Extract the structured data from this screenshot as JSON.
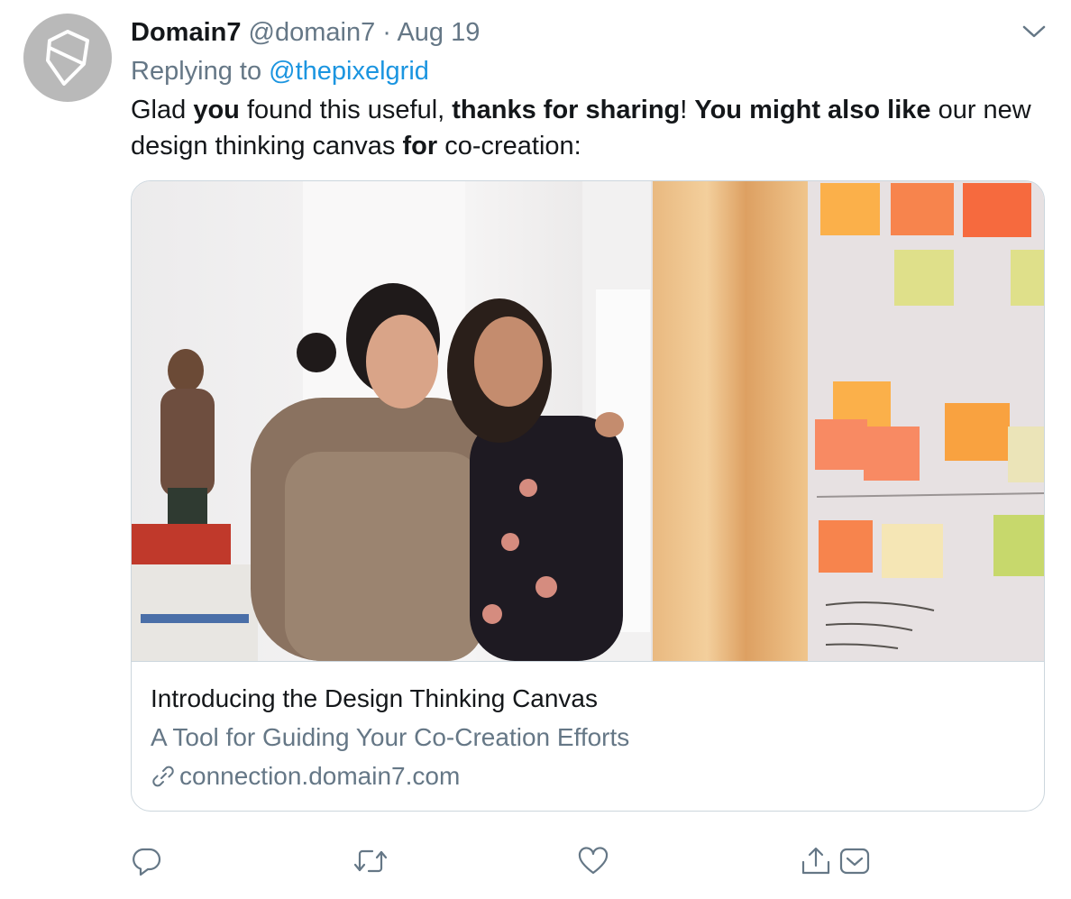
{
  "tweet": {
    "author_name": "Domain7",
    "author_handle": "@domain7",
    "separator": "·",
    "date": "Aug 19",
    "replying_prefix": "Replying to",
    "replying_to": "@thepixelgrid",
    "text": {
      "t1": "Glad ",
      "b1": "you",
      "t2": " found this useful, ",
      "b2": "thanks for sharing",
      "t3": "! ",
      "b3": "You might also like",
      "t4": " our new design thinking canvas ",
      "b4": "for",
      "t5": " co-creation:"
    }
  },
  "card": {
    "title": "Introducing the Design Thinking Canvas",
    "description": "A Tool for Guiding Your Co-Creation Efforts",
    "url": "connection.domain7.com"
  },
  "icons": {
    "avatar": "domain7-logo-icon",
    "menu": "chevron-down-icon",
    "link": "link-icon",
    "reply": "reply-icon",
    "retweet": "retweet-icon",
    "like": "heart-icon",
    "share": "share-icon",
    "dm": "direct-message-icon"
  },
  "colors": {
    "text": "#14171a",
    "muted": "#657786",
    "accent": "#1b95e0",
    "border": "#ccd6dd"
  }
}
